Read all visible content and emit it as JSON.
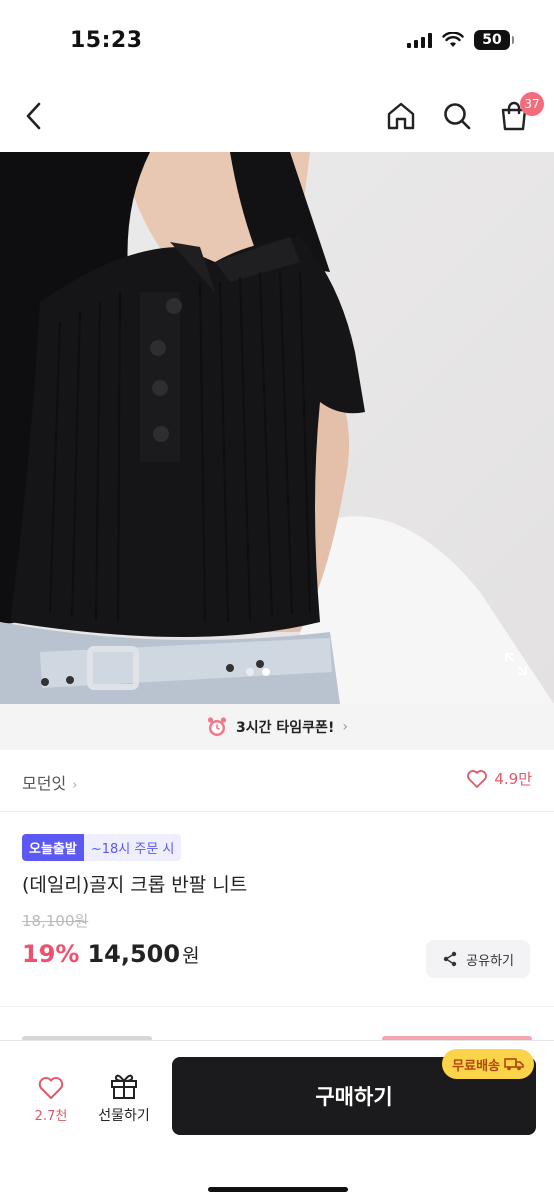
{
  "status_bar": {
    "time": "15:23",
    "battery": "50"
  },
  "nav": {
    "cart_count": "37"
  },
  "product_image": {
    "page_count": 2,
    "current_page": 2
  },
  "coupon": {
    "text": "3시간 타임쿠폰!"
  },
  "brand": {
    "name": "모던잇",
    "like_count": "4.9만"
  },
  "badges": {
    "today": "오늘출발",
    "cutoff": "~18시 주문 시"
  },
  "product": {
    "title": "(데일리)골지 크롭 반팔 니트",
    "original_price": "18,100원",
    "discount": "19%",
    "price": "14,500",
    "price_unit": "원"
  },
  "share": {
    "label": "공유하기"
  },
  "bottom": {
    "like_count": "2.7천",
    "gift_label": "선물하기",
    "buy_label": "구매하기",
    "free_shipping": "무료배송"
  },
  "colors": {
    "accent": "#f0506e",
    "badge_blue": "#5b58f3",
    "buy_button": "#1b1b1d",
    "free_ship": "#fbd44a"
  }
}
